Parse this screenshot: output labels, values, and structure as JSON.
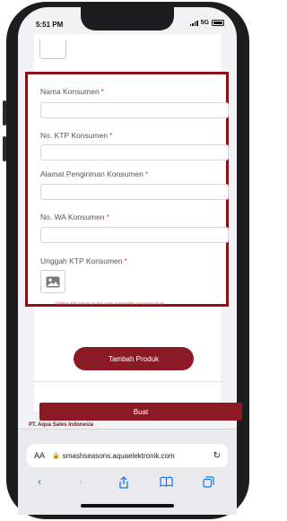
{
  "status_bar": {
    "time": "5:51 PM",
    "network": "5G"
  },
  "form": {
    "fields": [
      {
        "label": "Nama Konsumen",
        "required_mark": "*"
      },
      {
        "label": "No. KTP Konsumen",
        "required_mark": "*"
      },
      {
        "label": "Alamat Pengiriman Konsumen",
        "required_mark": "*"
      },
      {
        "label": "No. WA Konsumen",
        "required_mark": "*"
      }
    ],
    "upload_label": "Unggah KTP Konsumen",
    "upload_required_mark": "*",
    "hint": "Silahkan klik tambah produk untuk melanjutkan pengajuan klaim"
  },
  "buttons": {
    "add_product": "Tambah Produk",
    "create": "Buat"
  },
  "under_text": "PT. Aqua Sales Indonesia",
  "browser": {
    "aa_label": "AA",
    "url": "smashseasons.aquaelektronik.com"
  },
  "icons": {
    "lock": "lock-icon",
    "reload": "reload-icon",
    "back": "back-icon",
    "forward": "forward-icon",
    "share": "share-icon",
    "bookmarks": "bookmarks-icon",
    "tabs": "tabs-icon",
    "image": "image-icon"
  },
  "colors": {
    "brand": "#8b1a24",
    "form_border": "#8b1017",
    "required": "#d24b52",
    "link": "#0a7aff"
  }
}
